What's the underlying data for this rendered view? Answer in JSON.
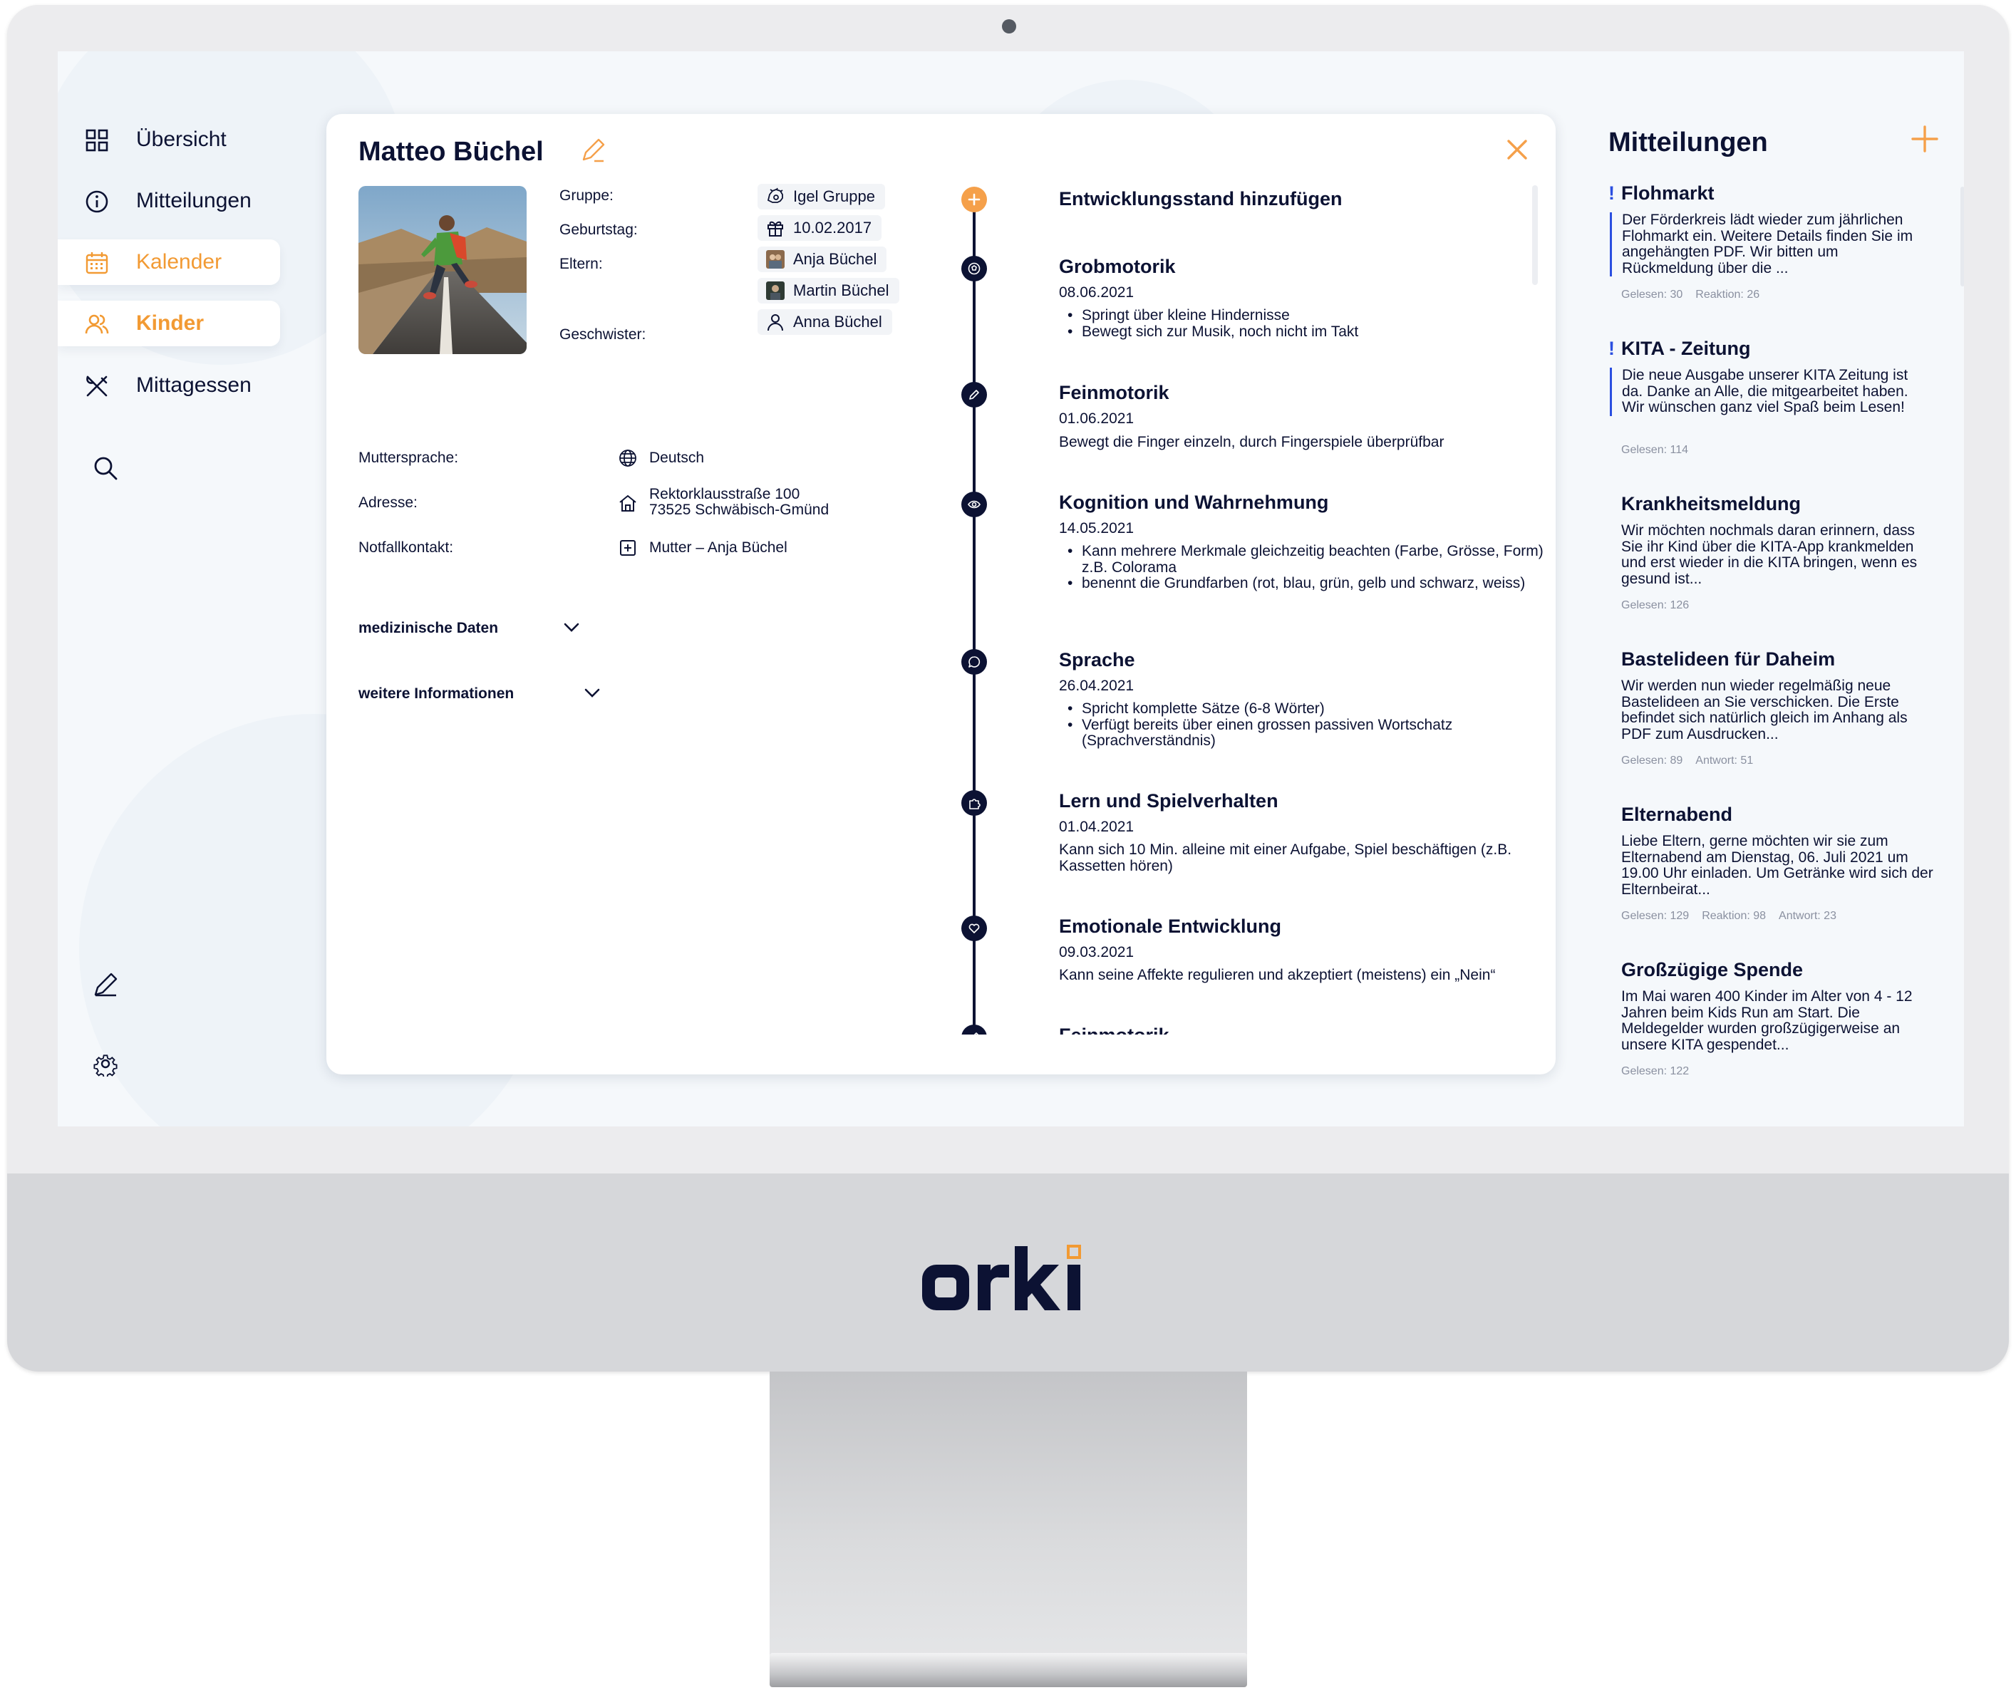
{
  "brand": {
    "logo_text": "orki",
    "accent": "#f29a33",
    "navy": "#0c1233",
    "alert": "#2b4fe0"
  },
  "nav": {
    "items": [
      {
        "label": "Übersicht",
        "icon": "grid-icon"
      },
      {
        "label": "Mitteilungen",
        "icon": "info-icon"
      },
      {
        "label": "Kalender",
        "icon": "calendar-icon"
      },
      {
        "label": "Kinder",
        "icon": "users-icon"
      },
      {
        "label": "Mittagessen",
        "icon": "utensils-icon"
      }
    ],
    "utility_icons": [
      "search-icon",
      "pen-icon",
      "gear-icon"
    ]
  },
  "child": {
    "name": "Matteo Büchel",
    "labels": {
      "group": "Gruppe:",
      "birthday": "Geburtstag:",
      "parents": "Eltern:",
      "siblings": "Geschwister:",
      "language": "Muttersprache:",
      "address": "Adresse:",
      "emergency": "Notfallkontakt:"
    },
    "group": "Igel Gruppe",
    "birthday": "10.02.2017",
    "parents": [
      "Anja Büchel",
      "Martin Büchel"
    ],
    "siblings": [
      "Anna Büchel"
    ],
    "language": "Deutsch",
    "address_line1": "Rektorklausstraße 100",
    "address_line2": "73525 Schwäbisch-Gmünd",
    "emergency": "Mutter – Anja Büchel",
    "accordion": {
      "medical": "medizinische Daten",
      "more": "weitere Informationen"
    }
  },
  "timeline": {
    "add_label": "Entwicklungsstand hinzufügen",
    "entries": [
      {
        "title": "Grobmotorik",
        "date": "08.06.2021",
        "icon": "football-icon",
        "bullets": [
          "Springt über kleine Hindernisse",
          "Bewegt sich zur Musik, noch nicht im Takt"
        ]
      },
      {
        "title": "Feinmotorik",
        "date": "01.06.2021",
        "icon": "pencil-icon",
        "text": "Bewegt die Finger einzeln, durch Fingerspiele überprüfbar"
      },
      {
        "title": "Kognition und Wahrnehmung",
        "date": "14.05.2021",
        "icon": "eye-icon",
        "bullets": [
          "Kann mehrere Merkmale gleichzeitig beachten (Farbe, Grösse, Form) z.B. Colorama",
          "benennt die Grundfarben (rot, blau, grün, gelb und schwarz, weiss)"
        ]
      },
      {
        "title": "Sprache",
        "date": "26.04.2021",
        "icon": "speech-bubble-icon",
        "bullets": [
          "Spricht komplette Sätze (6-8 Wörter)",
          "Verfügt bereits über einen grossen passiven Wortschatz (Sprachverständnis)"
        ]
      },
      {
        "title": "Lern und Spielverhalten",
        "date": "01.04.2021",
        "icon": "puzzle-icon",
        "text": "Kann sich 10 Min. alleine mit einer Aufgabe, Spiel beschäftigen (z.B. Kassetten hören)"
      },
      {
        "title": "Emotionale Entwicklung",
        "date": "09.03.2021",
        "icon": "heart-icon",
        "text": "Kann seine Affekte regulieren und akzeptiert (meistens) ein „Nein“"
      },
      {
        "title": "Feinmotorik",
        "icon": "pencil-icon"
      }
    ]
  },
  "messages": {
    "title": "Mitteilungen",
    "items": [
      {
        "title": "Flohmarkt",
        "flag": "!",
        "body": "Der Förderkreis lädt wieder zum jährlichen Flohmarkt ein. Weitere Details finden Sie im angehängten PDF. Wir bitten um Rückmeldung über die ...",
        "stats": [
          "Gelesen: 30",
          "Reaktion: 26"
        ]
      },
      {
        "title": "KITA - Zeitung",
        "flag": "!",
        "body": "Die neue Ausgabe unserer KITA Zeitung ist da. Danke an Alle, die mitgearbeitet haben. Wir wünschen ganz viel Spaß beim Lesen!",
        "stats": [
          "Gelesen: 114"
        ]
      },
      {
        "title": "Krankheitsmeldung",
        "body": "Wir möchten nochmals daran erinnern, dass Sie ihr Kind über die KITA-App krankmelden und erst wieder in die KITA bringen, wenn es gesund ist...",
        "stats": [
          "Gelesen: 126"
        ]
      },
      {
        "title": "Bastelideen für Daheim",
        "body": "Wir werden nun wieder regelmäßig neue Bastelideen an Sie verschicken. Die Erste befindet sich natürlich gleich im Anhang als PDF zum Ausdrucken...",
        "stats": [
          "Gelesen: 89",
          "Antwort: 51"
        ]
      },
      {
        "title": "Elternabend",
        "body": "Liebe Eltern, gerne möchten wir sie zum Elternabend am Dienstag, 06. Juli 2021 um 19.00 Uhr einladen. Um Getränke wird sich der Elternbeirat...",
        "stats": [
          "Gelesen: 129",
          "Reaktion: 98",
          "Antwort: 23"
        ]
      },
      {
        "title": "Großzügige Spende",
        "body": "Im Mai waren 400 Kinder im Alter von 4 - 12 Jahren beim Kids Run am Start. Die Meldegelder wurden großzügigerweise an unsere KITA gespendet...",
        "stats": [
          "Gelesen: 122"
        ]
      }
    ]
  }
}
